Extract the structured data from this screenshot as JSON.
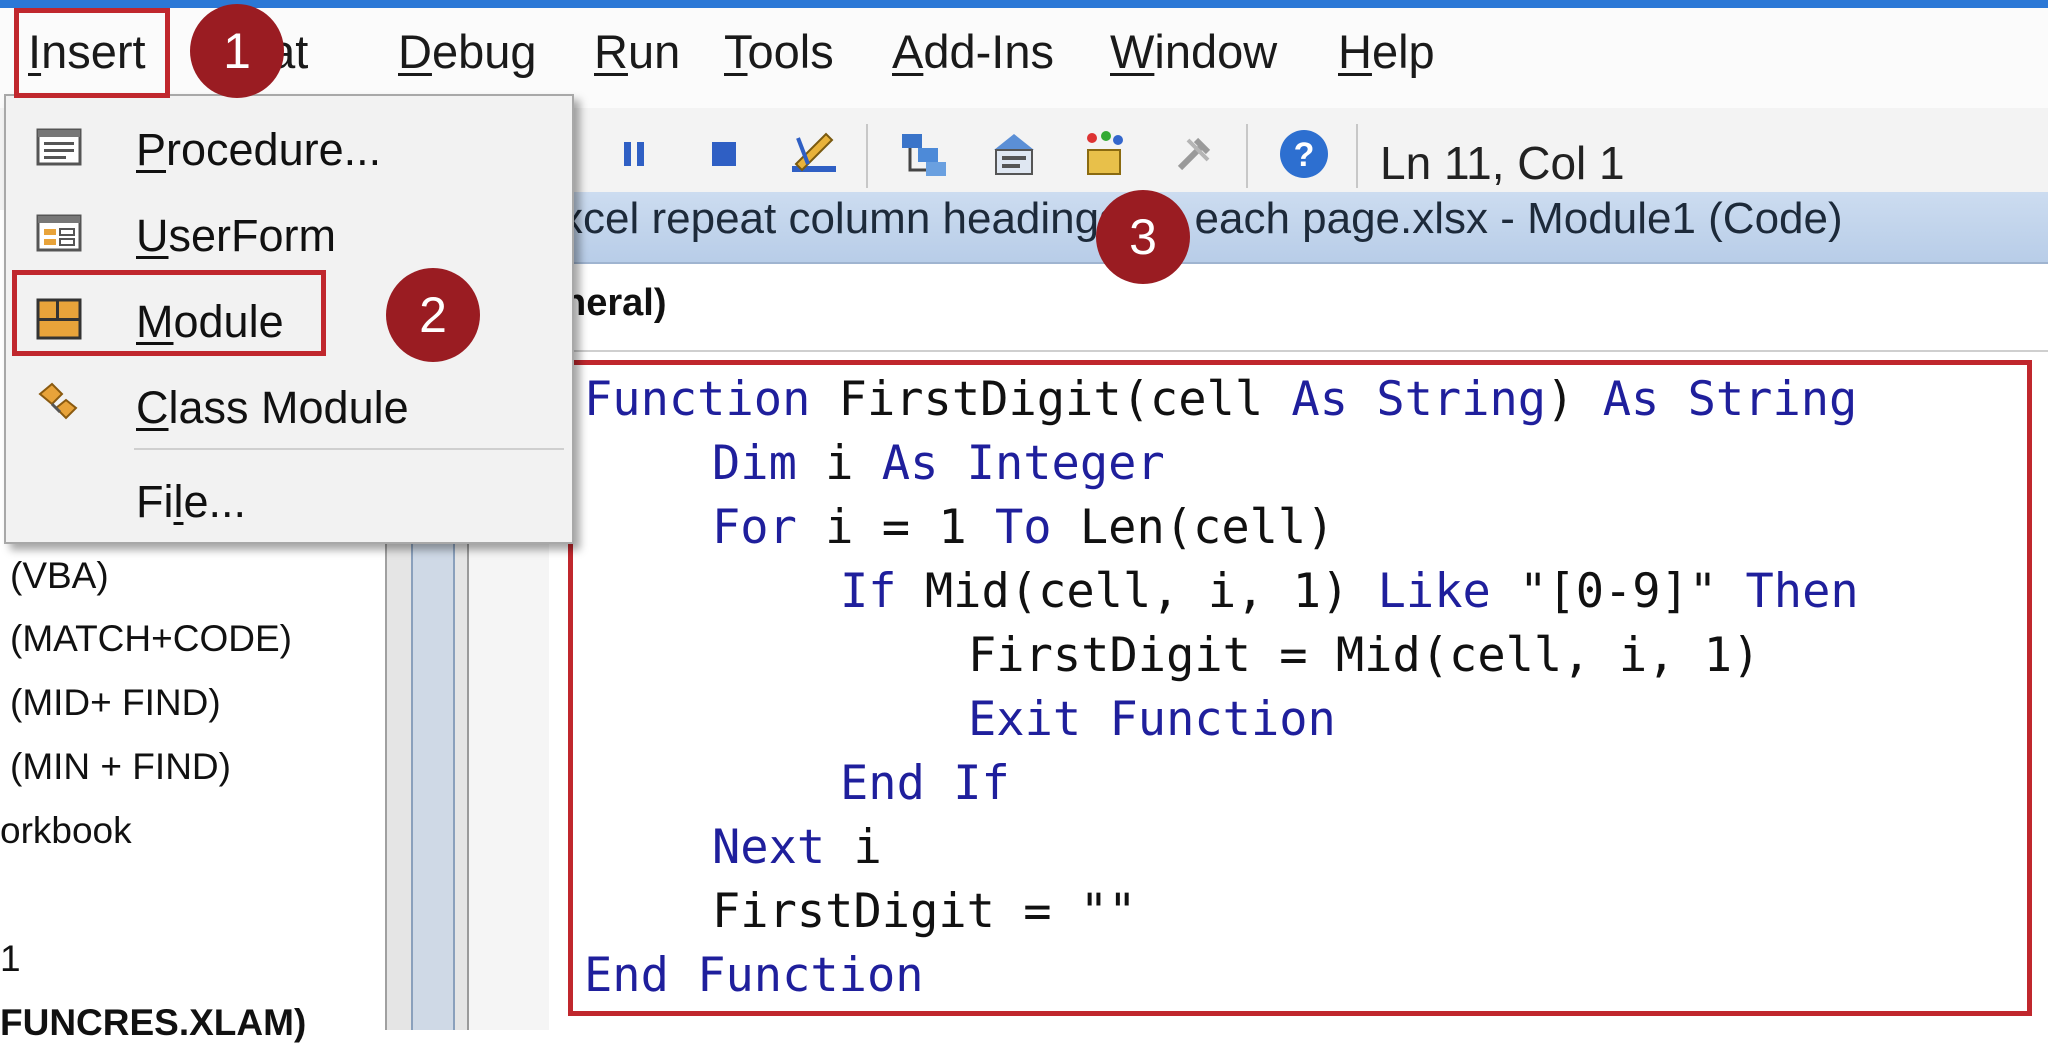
{
  "menubar": {
    "items": [
      {
        "label": "Insert",
        "mnemonic": "I"
      },
      {
        "label": "Format",
        "mnemonic": "o"
      },
      {
        "label": "Debug",
        "mnemonic": "D"
      },
      {
        "label": "Run",
        "mnemonic": "R"
      },
      {
        "label": "Tools",
        "mnemonic": "T"
      },
      {
        "label": "Add-Ins",
        "mnemonic": "A"
      },
      {
        "label": "Window",
        "mnemonic": "W"
      },
      {
        "label": "Help",
        "mnemonic": "H"
      }
    ],
    "insert_label": "nsert",
    "format_visible": "mat",
    "debug_rest": "ebug",
    "run_rest": "un",
    "tools_rest": "ools",
    "addins_rest": "dd-Ins",
    "window_rest": "indow",
    "help_rest": "elp"
  },
  "insert_menu": {
    "items": [
      {
        "label": "Procedure...",
        "icon": "procedure-icon"
      },
      {
        "label": "UserForm",
        "icon": "userform-icon"
      },
      {
        "label": "Module",
        "icon": "module-icon"
      },
      {
        "label": "Class Module",
        "icon": "class-module-icon"
      },
      {
        "label": "File...",
        "icon": ""
      }
    ],
    "procedure_rest": "rocedure...",
    "userform_rest": "serForm",
    "module_rest": "odule",
    "class_rest": "lass Module",
    "file_pre": "Fi",
    "file_mn": "l",
    "file_rest": "e..."
  },
  "toolbar": {
    "status": "Ln 11, Col 1"
  },
  "project_tree": {
    "items": [
      "(VBA)",
      "(MATCH+CODE)",
      "(MID+ FIND)",
      "(MIN + FIND)",
      "orkbook",
      "1",
      "FUNCRES.XLAM)"
    ]
  },
  "code_window": {
    "title": "xcel repeat column headings on each page.xlsx - Module1 (Code)",
    "object_combo": "neral)"
  },
  "code": {
    "l1_kw1": "Function",
    "l1_t1": " FirstDigit(cell ",
    "l1_kw2": "As",
    "l1_t2": " ",
    "l1_kw3": "String",
    "l1_t3": ") ",
    "l1_kw4": "As",
    "l1_t4": " ",
    "l1_kw5": "String",
    "l2_kw1": "Dim",
    "l2_t1": " i ",
    "l2_kw2": "As",
    "l2_t2": " ",
    "l2_kw3": "Integer",
    "l3_kw1": "For",
    "l3_t1": " i = 1 ",
    "l3_kw2": "To",
    "l3_t2": " Len(cell)",
    "l4_kw1": "If",
    "l4_t1": " Mid(cell, i, 1) ",
    "l4_kw2": "Like",
    "l4_t2": " \"[0-9]\" ",
    "l4_kw3": "Then",
    "l5_t1": "FirstDigit = Mid(cell, i, 1)",
    "l6_kw1": "Exit",
    "l6_t1": " ",
    "l6_kw2": "Function",
    "l7_kw1": "End",
    "l7_t1": " ",
    "l7_kw2": "If",
    "l8_kw1": "Next",
    "l8_t1": " i",
    "l9_t1": "FirstDigit = \"\"",
    "l10_kw1": "End",
    "l10_t1": " ",
    "l10_kw2": "Function"
  },
  "annotations": {
    "step1": "1",
    "step2": "2",
    "step3": "3"
  },
  "colors": {
    "highlight": "#c0272d",
    "badge": "#9a1c22",
    "keyword": "#1f1f9c"
  }
}
